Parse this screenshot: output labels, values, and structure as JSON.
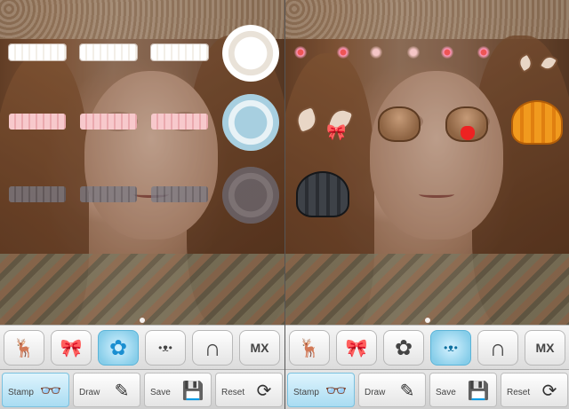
{
  "panels": [
    {
      "id": "left",
      "stamp_set": "lace",
      "categories": [
        {
          "name": "deer",
          "glyph": "🦌"
        },
        {
          "name": "bow",
          "glyph": "🎀"
        },
        {
          "name": "flower",
          "glyph": "✿"
        },
        {
          "name": "cat-face",
          "glyph": "•ᴥ•"
        },
        {
          "name": "hair",
          "glyph": "∩"
        },
        {
          "name": "mx-logo",
          "glyph": "MX"
        }
      ],
      "active_category": 2,
      "modes": {
        "stamp": "Stamp",
        "draw": "Draw",
        "save": "Save",
        "reset": "Reset"
      },
      "active_mode": "stamp"
    },
    {
      "id": "right",
      "stamp_set": "face-parts",
      "categories": [
        {
          "name": "deer",
          "glyph": "🦌"
        },
        {
          "name": "bow",
          "glyph": "🎀"
        },
        {
          "name": "flower",
          "glyph": "✿"
        },
        {
          "name": "cat-face",
          "glyph": "•ᴥ•"
        },
        {
          "name": "hair",
          "glyph": "∩"
        },
        {
          "name": "mx-logo",
          "glyph": "MX"
        }
      ],
      "active_category": 3,
      "modes": {
        "stamp": "Stamp",
        "draw": "Draw",
        "save": "Save",
        "reset": "Reset"
      },
      "active_mode": "stamp"
    }
  ],
  "colors": {
    "active_accent": "#86cde9",
    "toolbar_bg": "#dcdcdc"
  }
}
